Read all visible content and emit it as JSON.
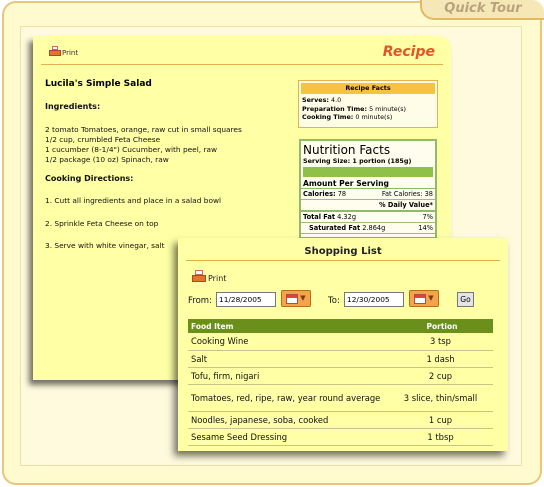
{
  "header": {
    "tour_label": "Quick Tour"
  },
  "recipe": {
    "print_label": "Print",
    "title": "Recipe",
    "name": "Lucila's Simple Salad",
    "ingredients_heading": "Ingredients:",
    "ingredients": [
      "2 tomato Tomatoes, orange, raw cut in small squares",
      "1/2 cup, crumbled Feta Cheese",
      "1 cucumber (8-1/4\") Cucumber, with peel, raw",
      "1/2 package (10 oz) Spinach, raw"
    ],
    "directions_heading": "Cooking Directions:",
    "directions": [
      "1. Cutt all ingredients and place in a salad bowl",
      "2. Sprinkle Feta Cheese on top",
      "3. Serve with white vinegar, salt"
    ],
    "facts": {
      "heading": "Recipe Facts",
      "serves_label": "Serves:",
      "serves_value": "4.0",
      "prep_label": "Preparation Time:",
      "prep_value": "5 minute(s)",
      "cook_label": "Cooking Time:",
      "cook_value": "0 minute(s)"
    },
    "nutrition": {
      "title": "Nutrition Facts",
      "serving_size": "Serving Size: 1 portion (185g)",
      "amount_heading": "Amount Per Serving",
      "calories_label": "Calories:",
      "calories_value": "78",
      "fat_calories_label": "Fat Calories:",
      "fat_calories_value": "38",
      "daily_value_label": "% Daily Value*",
      "total_fat_label": "Total Fat",
      "total_fat_value": "4.32g",
      "total_fat_pct": "7%",
      "sat_fat_label": "Saturated Fat",
      "sat_fat_value": "2.864g",
      "sat_fat_pct": "14%"
    }
  },
  "shopping": {
    "title": "Shopping List",
    "print_label": "Print",
    "from_label": "From:",
    "from_value": "11/28/2005",
    "to_label": "To:",
    "to_value": "12/30/2005",
    "go_label": "Go",
    "columns": {
      "item": "Food Item",
      "portion": "Portion"
    },
    "rows": [
      {
        "item": "Cooking Wine",
        "portion": "3 tsp"
      },
      {
        "item": "Salt",
        "portion": "1 dash"
      },
      {
        "item": "Tofu, firm, nigari",
        "portion": "2 cup"
      },
      {
        "item": "Tomatoes, red, ripe, raw, year round average",
        "portion": "3 slice, thin/small"
      },
      {
        "item": "Noodles, japanese, soba, cooked",
        "portion": "1 cup"
      },
      {
        "item": "Sesame Seed Dressing",
        "portion": "1 tbsp"
      }
    ],
    "colors": {
      "header_bg": "#6a8f1a",
      "card_bg": "#ffffa6"
    }
  }
}
